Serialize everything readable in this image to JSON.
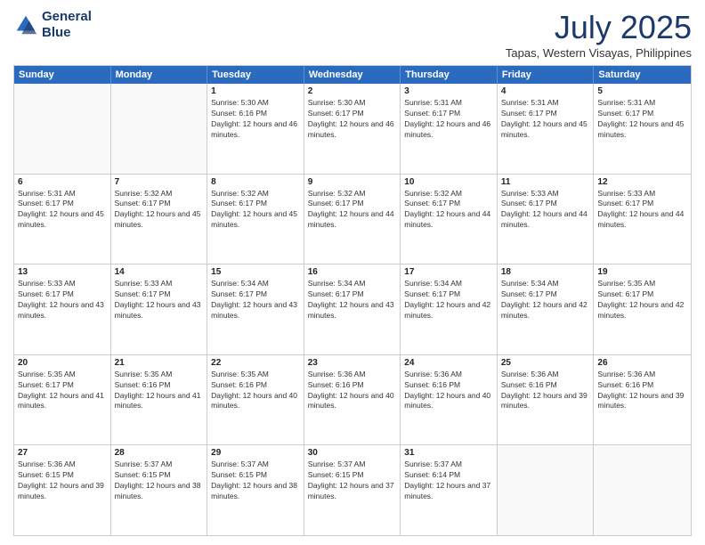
{
  "header": {
    "logo_line1": "General",
    "logo_line2": "Blue",
    "month": "July 2025",
    "location": "Tapas, Western Visayas, Philippines"
  },
  "days_of_week": [
    "Sunday",
    "Monday",
    "Tuesday",
    "Wednesday",
    "Thursday",
    "Friday",
    "Saturday"
  ],
  "weeks": [
    [
      {
        "day": "",
        "empty": true
      },
      {
        "day": "",
        "empty": true
      },
      {
        "day": "1",
        "rise": "Sunrise: 5:30 AM",
        "set": "Sunset: 6:16 PM",
        "daylight": "Daylight: 12 hours and 46 minutes."
      },
      {
        "day": "2",
        "rise": "Sunrise: 5:30 AM",
        "set": "Sunset: 6:17 PM",
        "daylight": "Daylight: 12 hours and 46 minutes."
      },
      {
        "day": "3",
        "rise": "Sunrise: 5:31 AM",
        "set": "Sunset: 6:17 PM",
        "daylight": "Daylight: 12 hours and 46 minutes."
      },
      {
        "day": "4",
        "rise": "Sunrise: 5:31 AM",
        "set": "Sunset: 6:17 PM",
        "daylight": "Daylight: 12 hours and 45 minutes."
      },
      {
        "day": "5",
        "rise": "Sunrise: 5:31 AM",
        "set": "Sunset: 6:17 PM",
        "daylight": "Daylight: 12 hours and 45 minutes."
      }
    ],
    [
      {
        "day": "6",
        "rise": "Sunrise: 5:31 AM",
        "set": "Sunset: 6:17 PM",
        "daylight": "Daylight: 12 hours and 45 minutes."
      },
      {
        "day": "7",
        "rise": "Sunrise: 5:32 AM",
        "set": "Sunset: 6:17 PM",
        "daylight": "Daylight: 12 hours and 45 minutes."
      },
      {
        "day": "8",
        "rise": "Sunrise: 5:32 AM",
        "set": "Sunset: 6:17 PM",
        "daylight": "Daylight: 12 hours and 45 minutes."
      },
      {
        "day": "9",
        "rise": "Sunrise: 5:32 AM",
        "set": "Sunset: 6:17 PM",
        "daylight": "Daylight: 12 hours and 44 minutes."
      },
      {
        "day": "10",
        "rise": "Sunrise: 5:32 AM",
        "set": "Sunset: 6:17 PM",
        "daylight": "Daylight: 12 hours and 44 minutes."
      },
      {
        "day": "11",
        "rise": "Sunrise: 5:33 AM",
        "set": "Sunset: 6:17 PM",
        "daylight": "Daylight: 12 hours and 44 minutes."
      },
      {
        "day": "12",
        "rise": "Sunrise: 5:33 AM",
        "set": "Sunset: 6:17 PM",
        "daylight": "Daylight: 12 hours and 44 minutes."
      }
    ],
    [
      {
        "day": "13",
        "rise": "Sunrise: 5:33 AM",
        "set": "Sunset: 6:17 PM",
        "daylight": "Daylight: 12 hours and 43 minutes."
      },
      {
        "day": "14",
        "rise": "Sunrise: 5:33 AM",
        "set": "Sunset: 6:17 PM",
        "daylight": "Daylight: 12 hours and 43 minutes."
      },
      {
        "day": "15",
        "rise": "Sunrise: 5:34 AM",
        "set": "Sunset: 6:17 PM",
        "daylight": "Daylight: 12 hours and 43 minutes."
      },
      {
        "day": "16",
        "rise": "Sunrise: 5:34 AM",
        "set": "Sunset: 6:17 PM",
        "daylight": "Daylight: 12 hours and 43 minutes."
      },
      {
        "day": "17",
        "rise": "Sunrise: 5:34 AM",
        "set": "Sunset: 6:17 PM",
        "daylight": "Daylight: 12 hours and 42 minutes."
      },
      {
        "day": "18",
        "rise": "Sunrise: 5:34 AM",
        "set": "Sunset: 6:17 PM",
        "daylight": "Daylight: 12 hours and 42 minutes."
      },
      {
        "day": "19",
        "rise": "Sunrise: 5:35 AM",
        "set": "Sunset: 6:17 PM",
        "daylight": "Daylight: 12 hours and 42 minutes."
      }
    ],
    [
      {
        "day": "20",
        "rise": "Sunrise: 5:35 AM",
        "set": "Sunset: 6:17 PM",
        "daylight": "Daylight: 12 hours and 41 minutes."
      },
      {
        "day": "21",
        "rise": "Sunrise: 5:35 AM",
        "set": "Sunset: 6:16 PM",
        "daylight": "Daylight: 12 hours and 41 minutes."
      },
      {
        "day": "22",
        "rise": "Sunrise: 5:35 AM",
        "set": "Sunset: 6:16 PM",
        "daylight": "Daylight: 12 hours and 40 minutes."
      },
      {
        "day": "23",
        "rise": "Sunrise: 5:36 AM",
        "set": "Sunset: 6:16 PM",
        "daylight": "Daylight: 12 hours and 40 minutes."
      },
      {
        "day": "24",
        "rise": "Sunrise: 5:36 AM",
        "set": "Sunset: 6:16 PM",
        "daylight": "Daylight: 12 hours and 40 minutes."
      },
      {
        "day": "25",
        "rise": "Sunrise: 5:36 AM",
        "set": "Sunset: 6:16 PM",
        "daylight": "Daylight: 12 hours and 39 minutes."
      },
      {
        "day": "26",
        "rise": "Sunrise: 5:36 AM",
        "set": "Sunset: 6:16 PM",
        "daylight": "Daylight: 12 hours and 39 minutes."
      }
    ],
    [
      {
        "day": "27",
        "rise": "Sunrise: 5:36 AM",
        "set": "Sunset: 6:15 PM",
        "daylight": "Daylight: 12 hours and 39 minutes."
      },
      {
        "day": "28",
        "rise": "Sunrise: 5:37 AM",
        "set": "Sunset: 6:15 PM",
        "daylight": "Daylight: 12 hours and 38 minutes."
      },
      {
        "day": "29",
        "rise": "Sunrise: 5:37 AM",
        "set": "Sunset: 6:15 PM",
        "daylight": "Daylight: 12 hours and 38 minutes."
      },
      {
        "day": "30",
        "rise": "Sunrise: 5:37 AM",
        "set": "Sunset: 6:15 PM",
        "daylight": "Daylight: 12 hours and 37 minutes."
      },
      {
        "day": "31",
        "rise": "Sunrise: 5:37 AM",
        "set": "Sunset: 6:14 PM",
        "daylight": "Daylight: 12 hours and 37 minutes."
      },
      {
        "day": "",
        "empty": true
      },
      {
        "day": "",
        "empty": true
      }
    ]
  ]
}
